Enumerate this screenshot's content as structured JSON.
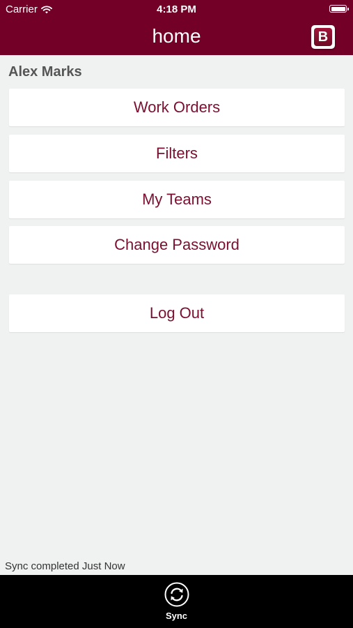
{
  "status_bar": {
    "carrier": "Carrier",
    "time": "4:18 PM"
  },
  "header": {
    "title": "home",
    "logo_letter": "B"
  },
  "user": {
    "name": "Alex Marks"
  },
  "menu": {
    "items": [
      {
        "label": "Work Orders"
      },
      {
        "label": "Filters"
      },
      {
        "label": "My Teams"
      },
      {
        "label": "Change Password"
      }
    ],
    "logout_label": "Log Out"
  },
  "sync_status": "Sync completed Just Now",
  "tab_bar": {
    "sync_label": "Sync"
  },
  "colors": {
    "brand": "#720027",
    "button_text": "#7a0f30",
    "background": "#f0f1f1",
    "tab_bar": "#000000"
  },
  "icons": [
    "wifi-icon",
    "battery-icon",
    "logo-icon",
    "sync-icon"
  ]
}
